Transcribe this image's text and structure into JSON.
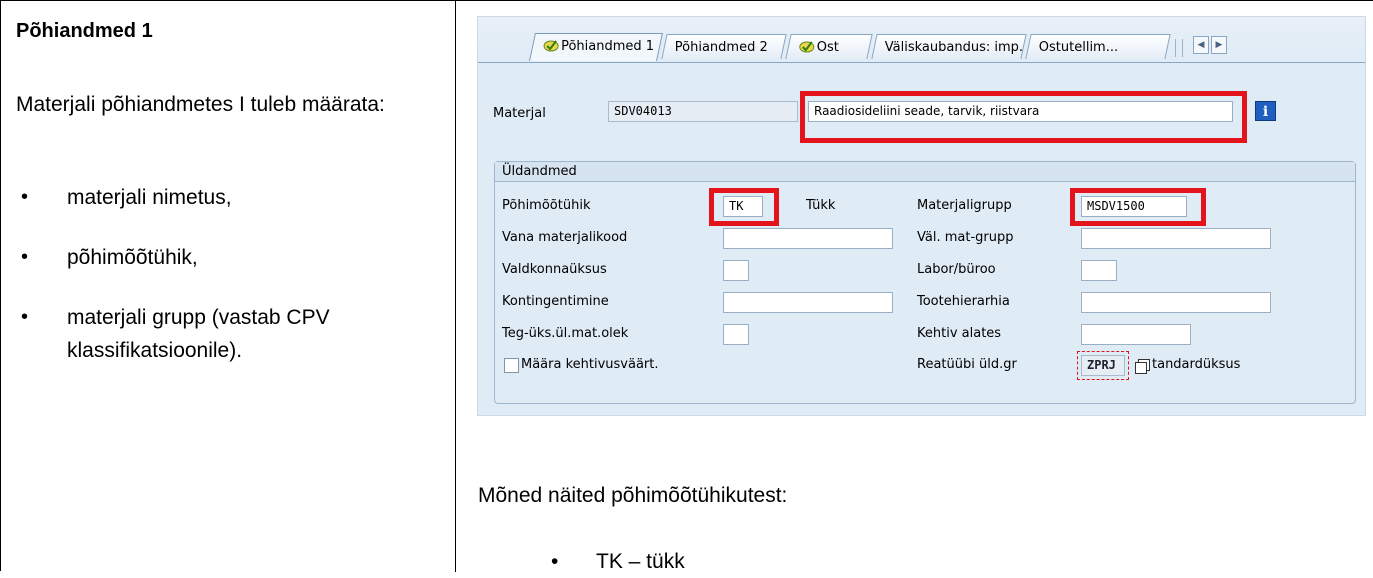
{
  "left": {
    "heading": "Põhiandmed 1",
    "intro": "Materjali põhiandmetes I  tuleb määrata:",
    "bullets": [
      "materjali nimetus,",
      "põhimõõtühik,",
      "materjali grupp (vastab CPV klassifikatsioonile)."
    ]
  },
  "sap": {
    "tabs": [
      "Põhiandmed 1",
      "Põhiandmed 2",
      "Ost",
      "Väliskaubandus: imp.",
      "Ostutellim..."
    ],
    "material_label": "Materjal",
    "material_code": "SDV04013",
    "material_desc": "Raadiosideliini seade, tarvik, riistvara",
    "group_title": "Üldandmed",
    "fields": {
      "base_unit_label": "Põhimõõtühik",
      "base_unit_value": "TK",
      "base_unit_text": "Tükk",
      "old_material_label": "Vana materjalikood",
      "division_label": "Valdkonnaüksus",
      "allocation_label": "Kontingentimine",
      "xplant_status_label": "Teg-üks.ül.mat.olek",
      "assign_eff_label": "Määra kehtivusväärt.",
      "material_group_label": "Materjaligrupp",
      "material_group_value": "MSDV1500",
      "ext_group_label": "Väl. mat-grupp",
      "lab_office_label": "Labor/büroo",
      "prod_hier_label": "Tootehierarhia",
      "valid_from_label": "Kehtiv alates",
      "item_cat_label": "Reatüübi üld.gr",
      "item_cat_value": "ZPRJ",
      "item_cat_text": "tandardüksus"
    }
  },
  "examples": {
    "title": "Mõned näited põhimõõtühikutest:",
    "bullets": [
      "TK – tükk"
    ]
  },
  "colors": {
    "highlight": "#e3141c",
    "sap_bg": "#dfebf5",
    "info_blue": "#1f5fbf"
  }
}
